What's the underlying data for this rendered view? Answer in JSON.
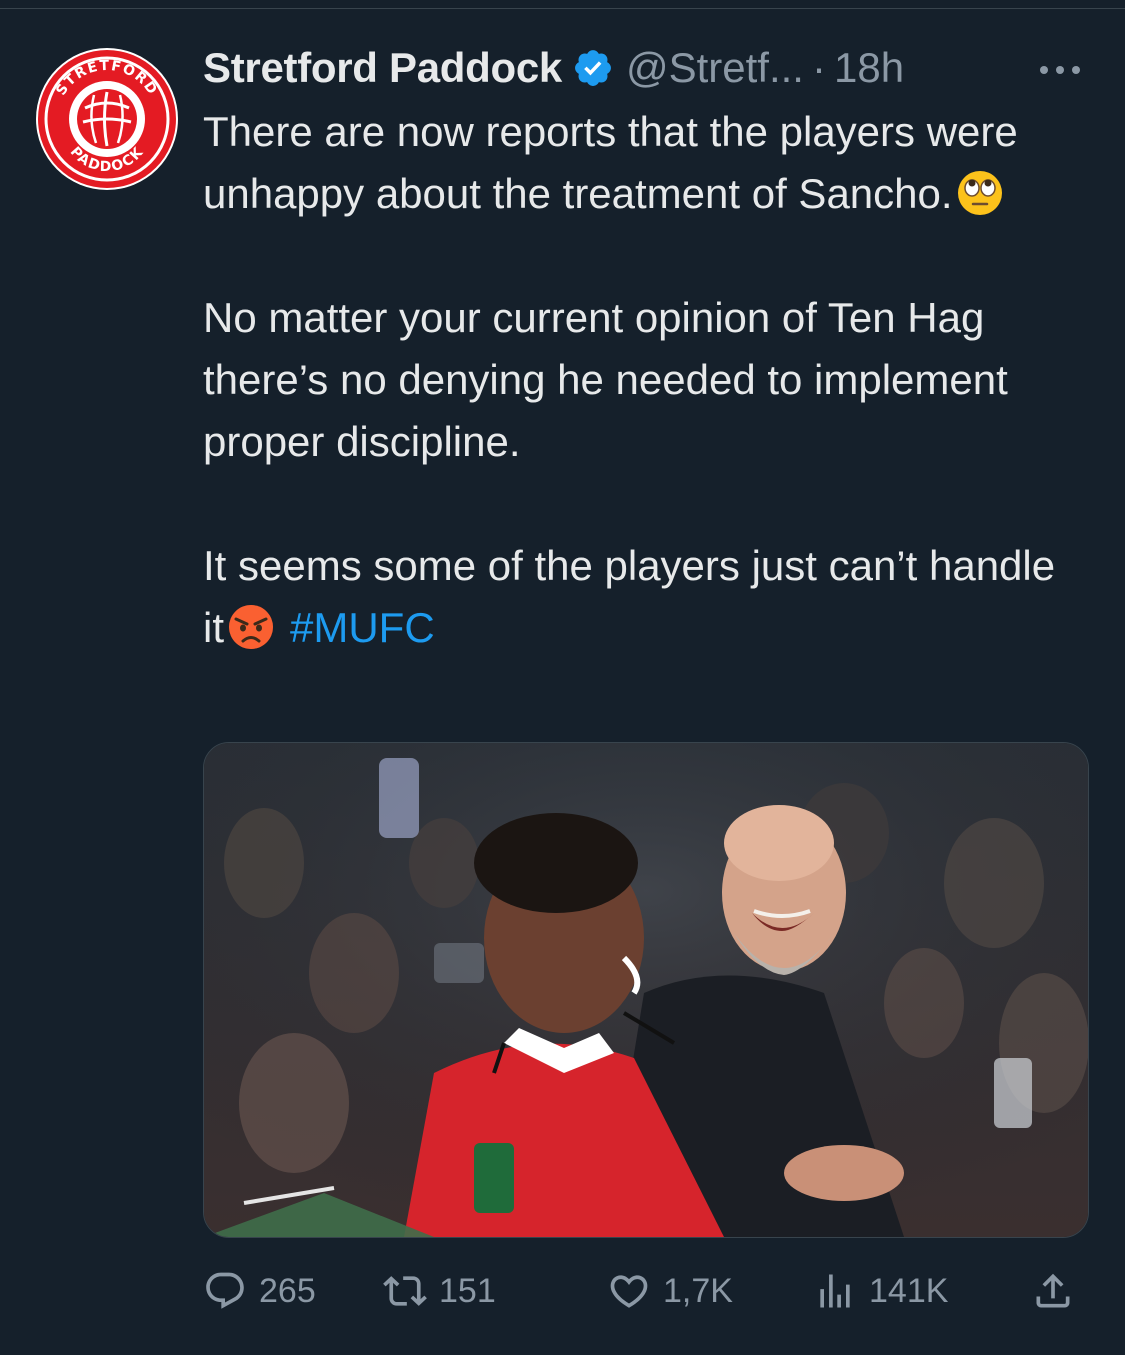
{
  "tweet": {
    "author": {
      "display_name": "Stretford Paddock",
      "handle": "@Stretf...",
      "verified": true,
      "avatar_text_top": "STRETFORD",
      "avatar_text_bottom": "PADDOCK"
    },
    "separator": "·",
    "time": "18h",
    "text": {
      "paragraph_1": "There are now reports that the players were unhappy about the treatment of Sancho.",
      "paragraph_1_emoji": "face-with-rolling-eyes",
      "paragraph_2": "No matter your current opinion of Ten Hag there’s no denying he needed to implement proper discipline.",
      "paragraph_3": "It seems some of the players just can’t handle it",
      "paragraph_3_emoji": "pouting-face",
      "hashtag": "#MUFC"
    },
    "media": {
      "kind": "photo"
    },
    "metrics": {
      "replies": "265",
      "retweets": "151",
      "likes": "1,7K",
      "views": "141K"
    }
  },
  "colors": {
    "background": "#15202b",
    "text_primary": "#e7e9ea",
    "text_secondary": "#8b98a5",
    "link": "#1d9bf0",
    "verified": "#1d9bf0",
    "brand_red": "#e41b23"
  },
  "icons": [
    "more-icon",
    "verified-badge-icon",
    "reply-icon",
    "retweet-icon",
    "like-icon",
    "views-icon",
    "share-icon"
  ]
}
